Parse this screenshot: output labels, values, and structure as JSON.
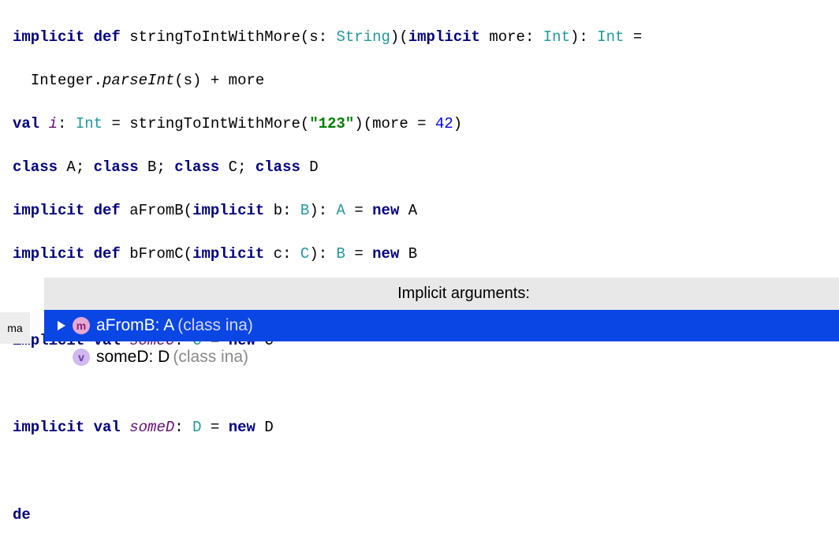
{
  "code": {
    "line1": {
      "kw1": "implicit",
      "kw2": "def",
      "fn": "stringToIntWithMore",
      "p1": "(s: ",
      "type1": "String",
      "p2": ")(",
      "kw3": "implicit",
      "p3": " more: ",
      "type2": "Int",
      "p4": "): ",
      "type3": "Int",
      "p5": " ="
    },
    "line2": {
      "indent": "  ",
      "txt1": "Integer.",
      "fn": "parseInt",
      "txt2": "(s) + more"
    },
    "line3": {
      "kw1": "val",
      "var": "i",
      "txt1": ": ",
      "type": "Int",
      "txt2": " = stringToIntWithMore(",
      "str": "\"123\"",
      "txt3": ")(more = ",
      "num": "42",
      "txt4": ")"
    },
    "line4": {
      "kw1": "class",
      "t1": " A; ",
      "kw2": "class",
      "t2": " B; ",
      "kw3": "class",
      "t3": " C; ",
      "kw4": "class",
      "t4": " D"
    },
    "line5": {
      "kw1": "implicit",
      "kw2": "def",
      "fn": "aFromB",
      "p1": "(",
      "kw3": "implicit",
      "p2": " b: ",
      "type1": "B",
      "p3": "): ",
      "type2": "A",
      "p4": " = ",
      "kw4": "new",
      "p5": " A"
    },
    "line6": {
      "kw1": "implicit",
      "kw2": "def",
      "fn": "bFromC",
      "p1": "(",
      "kw3": "implicit",
      "p2": " c: ",
      "type1": "C",
      "p3": "): ",
      "type2": "B",
      "p4": " = ",
      "kw4": "new",
      "p5": " B"
    },
    "line8": {
      "kw1": "implicit",
      "kw2": "val",
      "var": "someC",
      "txt1": ": ",
      "type": "C",
      "txt2": " = ",
      "kw3": "new",
      "txt3": " C"
    },
    "line10": {
      "kw1": "implicit",
      "kw2": "val",
      "var": "someD",
      "txt1": ": ",
      "type": "D",
      "txt2": " = ",
      "kw3": "new",
      "txt3": " D"
    },
    "line12": {
      "kw1": "de"
    }
  },
  "gutter": {
    "label": "ma"
  },
  "popup": {
    "header": "Implicit arguments:",
    "items": [
      {
        "icon": "m",
        "name": "aFromB: A",
        "tail": "  (class ina)"
      },
      {
        "icon": "v",
        "name": "someD: D",
        "tail": "  (class ina)"
      }
    ]
  }
}
